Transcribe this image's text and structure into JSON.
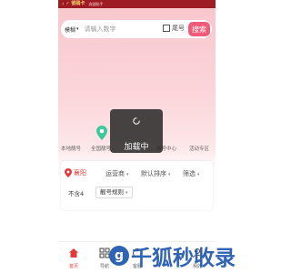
{
  "topbar": {
    "back_glyph": "‹",
    "app_logo": "✓ 號碼卡",
    "app_name": "选號助手"
  },
  "search": {
    "mode_label": "模糊",
    "mode_caret": "▾",
    "placeholder": "请输入数字",
    "tail_checkbox_label": "尾号",
    "search_button": "搜索"
  },
  "categories": [
    {
      "label": "本地靓号"
    },
    {
      "label": "全国靓号"
    },
    {
      "label": "靓号中心"
    },
    {
      "label": "活动专区"
    }
  ],
  "filters": {
    "city": "襄阳",
    "operator": "运营商",
    "sort": "默认排序",
    "filter": "筛选",
    "no4": "不含4",
    "rule": "靓号规则",
    "caret": "▾"
  },
  "loading": {
    "text": "加载中"
  },
  "bottom_nav": [
    {
      "label": "首页",
      "icon": "home-icon",
      "active": true
    },
    {
      "label": "导航",
      "icon": "grid-icon",
      "active": false
    },
    {
      "label": "客服",
      "icon": "service-icon",
      "active": false
    },
    {
      "label": "我的",
      "icon": "user-icon",
      "active": false
    }
  ],
  "watermark": {
    "text": "千狐秒收录",
    "badge": "g"
  },
  "colors": {
    "brand_dark": "#9e1d24",
    "accent": "#f35a79",
    "city": "#e23b3b",
    "pin_green": "#3ec99c",
    "watermark": "#2f63b3"
  }
}
